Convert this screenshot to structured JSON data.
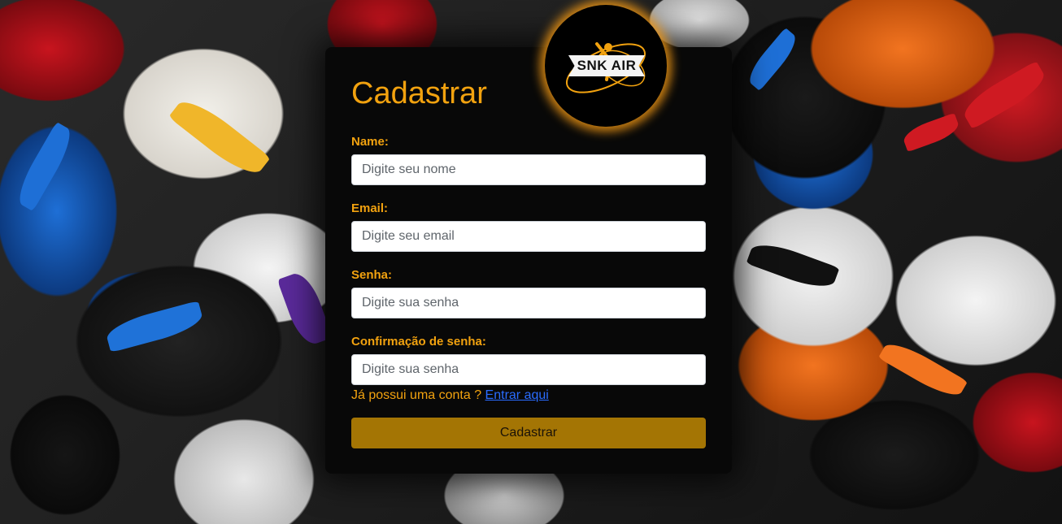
{
  "form": {
    "title": "Cadastrar",
    "logo_text": "SNK AIR",
    "fields": [
      {
        "label": "Name:",
        "placeholder": "Digite seu nome",
        "value": ""
      },
      {
        "label": "Email:",
        "placeholder": "Digite seu email",
        "value": ""
      },
      {
        "label": "Senha:",
        "placeholder": "Digite sua senha",
        "value": ""
      },
      {
        "label": "Confirmação de senha:",
        "placeholder": "Digite sua senha",
        "value": ""
      }
    ],
    "account_prompt": "Já possui uma conta ?",
    "login_link": "Entrar aqui",
    "submit_label": "Cadastrar"
  },
  "colors": {
    "accent": "#f2a20f",
    "button": "#a47504",
    "card": "#080808",
    "link": "#2a6cff"
  },
  "icons": {
    "logo": "basketball-jumpman-logo",
    "background": "sneaker-pile-background"
  }
}
